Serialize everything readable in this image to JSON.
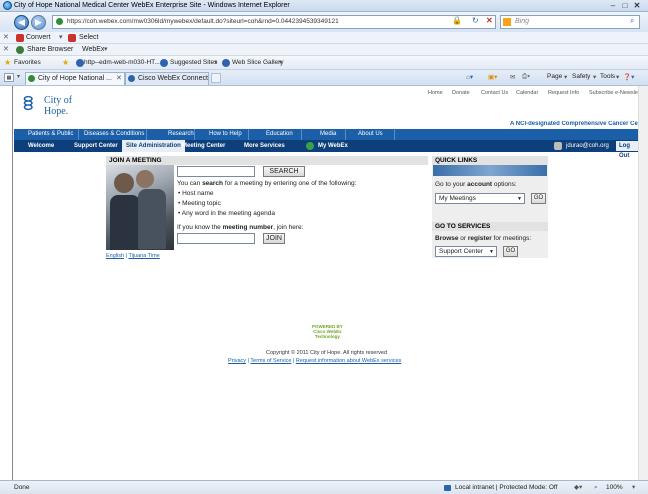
{
  "window": {
    "title": "City of Hope National Medical Center WebEx Enterprise Site - Windows Internet Explorer"
  },
  "browser": {
    "address": "https://coh.webex.com/mw0306ld/mywebex/default.do?siteurl=coh&rnd=0.0442394539349121",
    "search_placeholder": "Bing",
    "toolbar1": {
      "convert": "Convert",
      "select": "Select"
    },
    "toolbar2": {
      "share": "Share Browser",
      "webex": "WebEx"
    },
    "favorites_bar": {
      "favorites": "Favorites",
      "link1": "http--edm-web-m030-HT...",
      "link2": "Suggested Sites",
      "link3": "Web Slice Gallery"
    },
    "tabs": [
      {
        "label": "City of Hope National ..."
      },
      {
        "label": "Cisco WebEx Connect"
      }
    ],
    "command_bar": {
      "page": "Page",
      "safety": "Safety",
      "tools": "Tools"
    }
  },
  "site": {
    "top_links": [
      "Home",
      "Donate",
      "Contact Us",
      "Calendar",
      "Request Info",
      "Subscribe e-Newsletter"
    ],
    "logo_line1": "City of",
    "logo_line2": "Hope.",
    "tagline": "A NCI-designated Comprehensive Cancer Center",
    "nav": [
      "Patients & Public",
      "Diseases & Conditions",
      "Research",
      "How to Help",
      "Education",
      "Media",
      "About Us"
    ],
    "subnav": [
      "Welcome",
      "Support Center",
      "Site Administration",
      "Meeting Center",
      "More Services",
      "My WebEx"
    ],
    "user_email": "jdurao@coh.org",
    "logout": "Log Out"
  },
  "join_meeting": {
    "header": "JOIN A MEETING",
    "search_button": "SEARCH",
    "search_desc_prefix": "You can ",
    "search_desc_bold": "search",
    "search_desc_suffix": " for a meeting by entering one of the following:",
    "bullets": [
      "Host name",
      "Meeting topic",
      "Any word in the meeting agenda"
    ],
    "number_prefix": "If you know the ",
    "number_bold": "meeting number",
    "number_suffix": ", join here:",
    "join_button": "JOIN",
    "lang_english": "English",
    "lang_tijuana": "Tijuana Time"
  },
  "quick_links": {
    "header": "QUICK LINKS",
    "account_prefix": "Go to your ",
    "account_bold": "account",
    "account_suffix": " options:",
    "account_select": "My Meetings",
    "go1": "GO",
    "services_header": "GO TO SERVICES",
    "services_browse": "Browse",
    "services_or": " or ",
    "services_register": "register",
    "services_suffix": " for meetings:",
    "services_select": "Support Center",
    "go2": "GO"
  },
  "footer": {
    "powered_by": "POWERED BY",
    "cisco_webex": "Cisco WebEx",
    "technology": "Technology",
    "copyright": "Copyright © 2011 City of Hope. All rights reserved",
    "privacy": "Privacy",
    "terms": "Terms of Service",
    "request_info": "Request information about WebEx services"
  },
  "status": {
    "left": "Done",
    "zone": "Local intranet | Protected Mode: Off",
    "zoom": "100%"
  }
}
